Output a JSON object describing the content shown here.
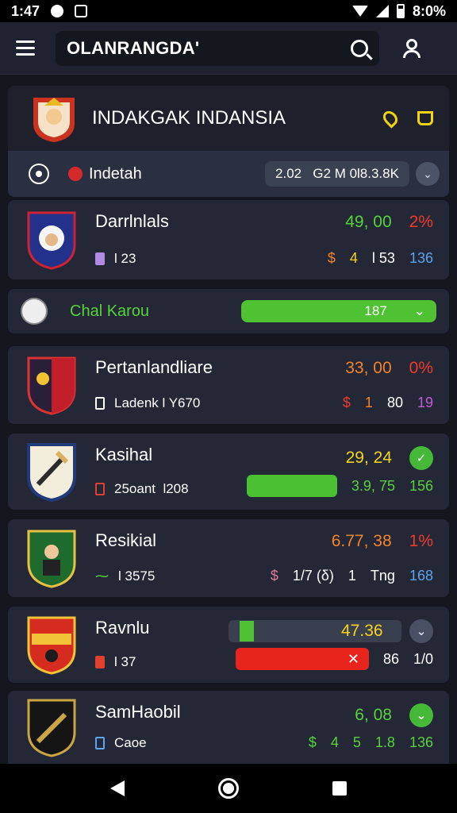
{
  "status_bar": {
    "time": "1:47",
    "battery_text": "8:0%"
  },
  "app_bar": {
    "title": "OLANRANGDA'"
  },
  "league": {
    "name": "INDAKGAK INDANSIA",
    "sub_label": "Indetah",
    "sub_value": "2.02   G2 M 0l8.3.8K"
  },
  "teams": [
    {
      "name": "Darrlnlals",
      "meta": "l 23",
      "score": "49, 00",
      "pct": "2%",
      "extra": [
        "$",
        "4",
        "l 53",
        "136"
      ],
      "colors": {
        "score": "#57d23a",
        "pct": "#ee3b2c"
      }
    },
    {
      "name": "Pertanlandliare",
      "meta": "Ladenk l Y670",
      "score": "33, 00",
      "pct": "0%",
      "extra": [
        "$",
        "1",
        "80",
        "19"
      ],
      "colors": {
        "score": "#f3832a",
        "pct": "#ee3b2c"
      }
    },
    {
      "name": "Kasihal",
      "meta": "25oant  l208",
      "score": "29, 24",
      "bar_text": "3.9, 75",
      "extra_last": "156"
    },
    {
      "name": "Resikial",
      "meta": "l 3575",
      "score": "6.77, 38",
      "pct": "1%",
      "extra": [
        "$",
        "1/7 (δ)",
        "1",
        "Tng",
        "168"
      ]
    },
    {
      "name": "Ravnlu",
      "meta": "l 37",
      "score": "47.36",
      "red_bar_extra": [
        "86",
        "1/0"
      ]
    },
    {
      "name": "SamHaobil",
      "meta": "Caoe",
      "score": "6, 08",
      "extra": [
        "$",
        "4",
        "5",
        "1.8",
        "136"
      ]
    }
  ],
  "spotlight": {
    "name": "Chal Karou",
    "value": "187"
  }
}
